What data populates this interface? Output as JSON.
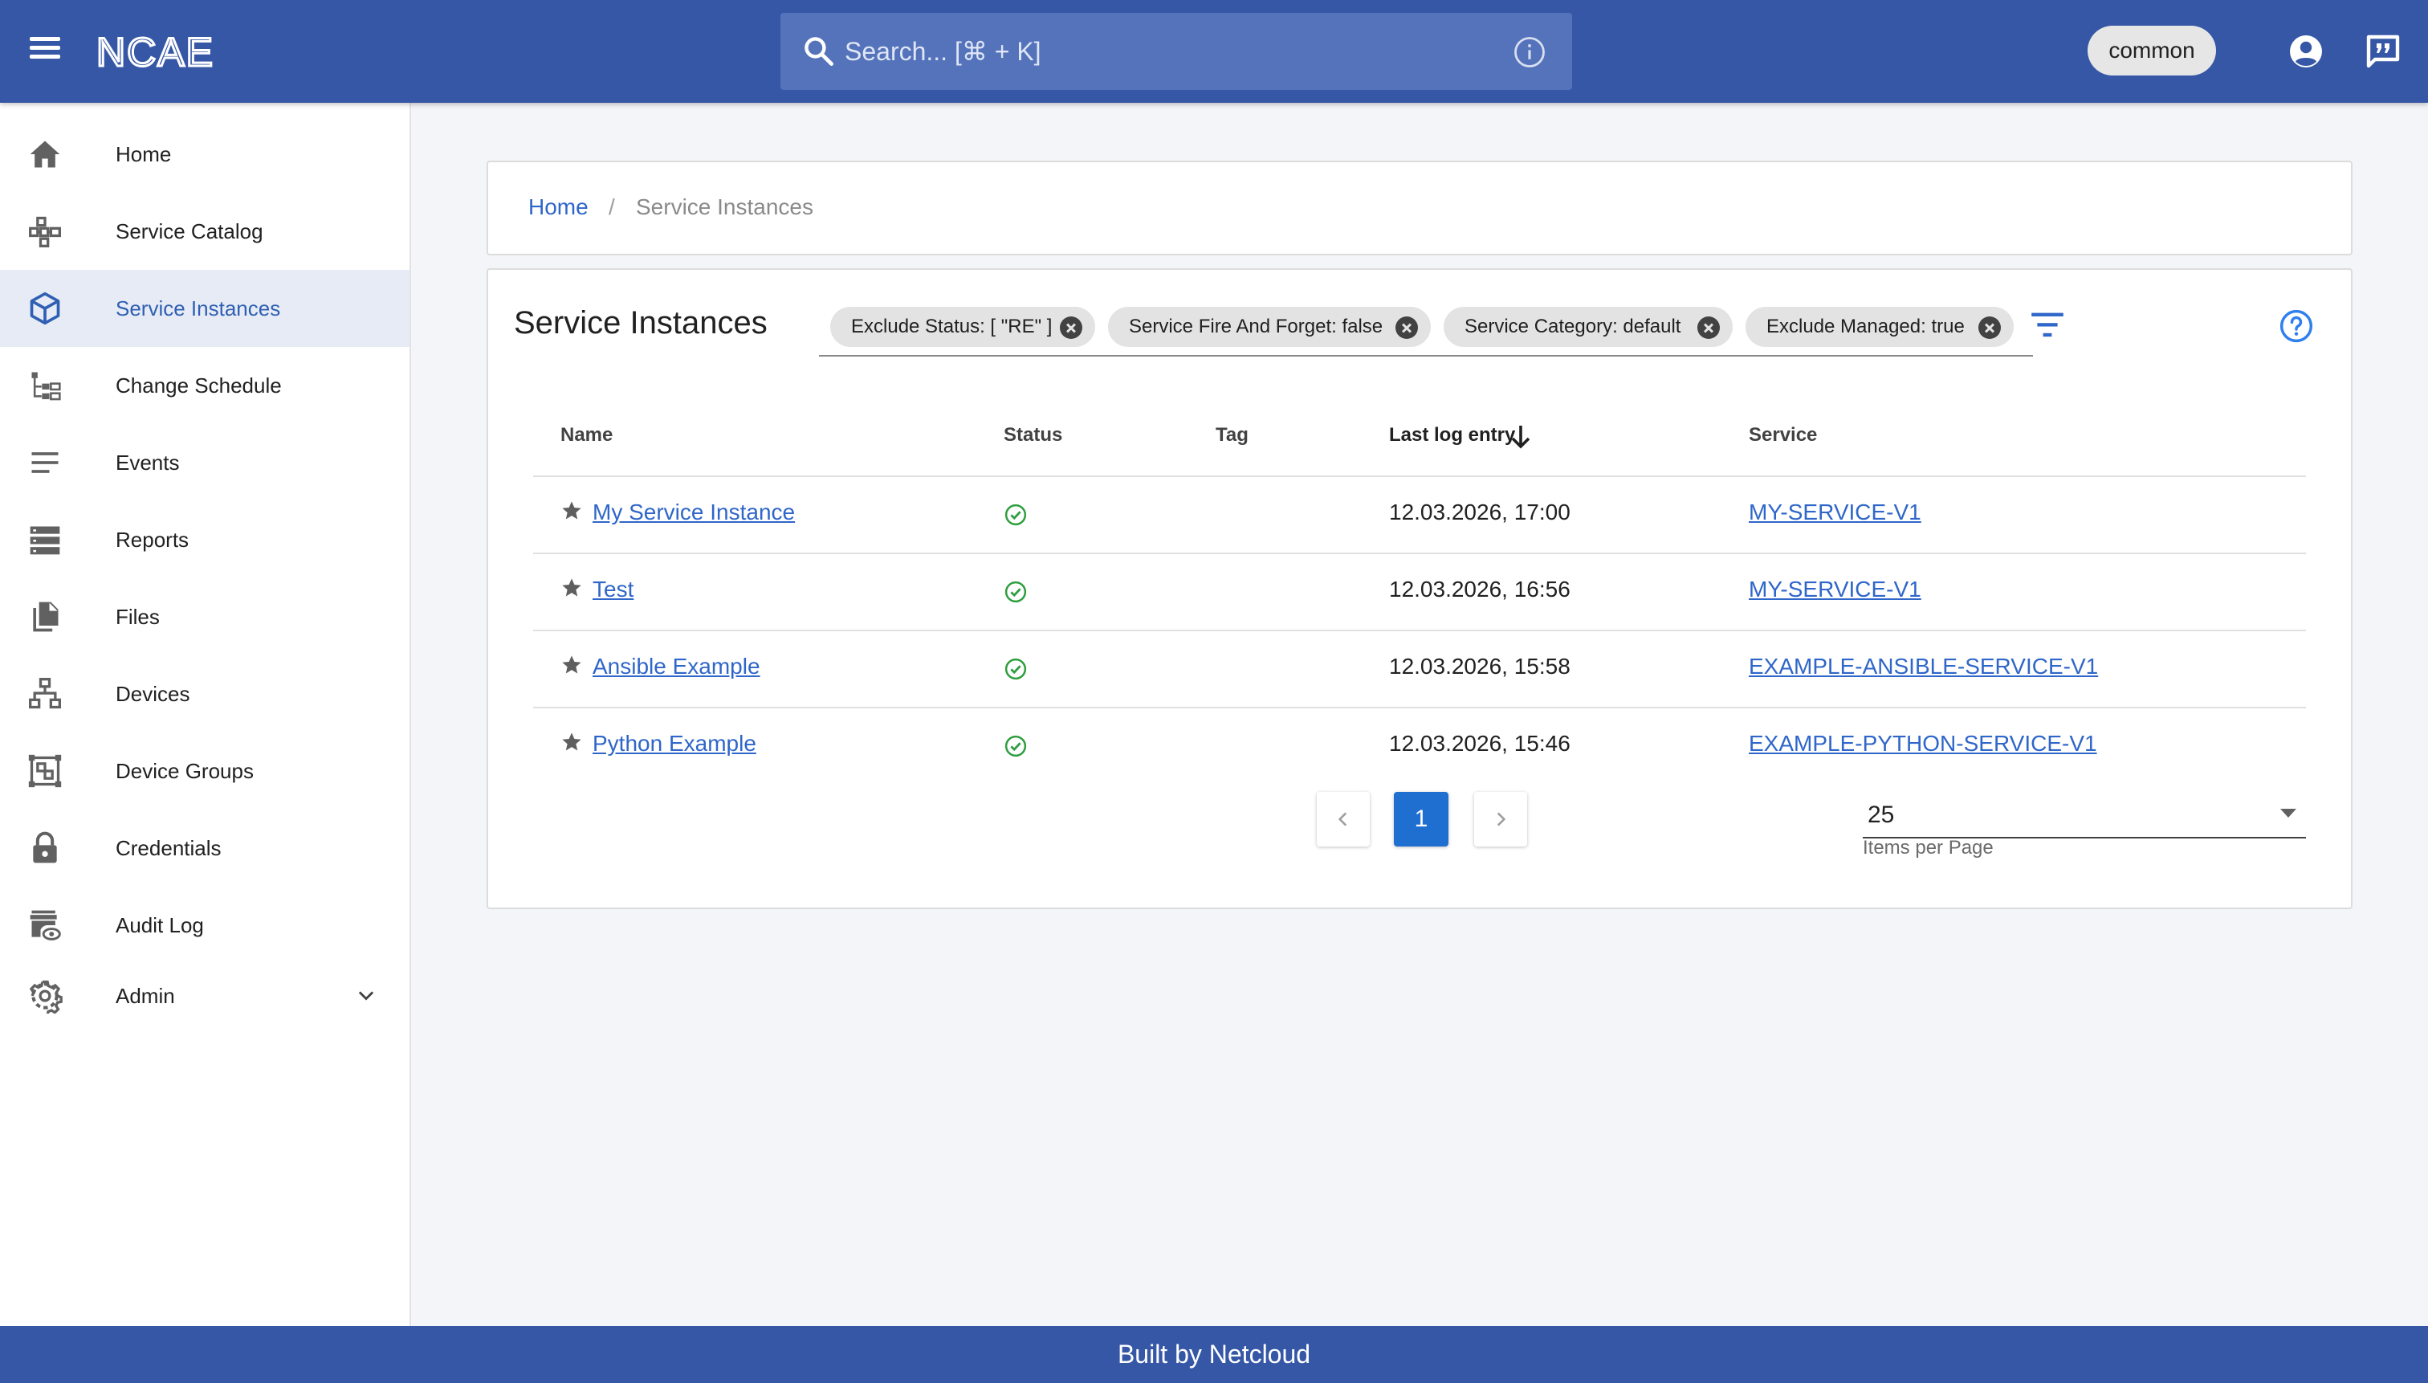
{
  "header": {
    "logo_text": "NCAE",
    "search_placeholder": "Search... [⌘ + K]",
    "tenant": "common",
    "brand_color": "#3657a6"
  },
  "sidebar": {
    "items": [
      {
        "label": "Home",
        "icon": "home-icon"
      },
      {
        "label": "Service Catalog",
        "icon": "service-catalog-icon"
      },
      {
        "label": "Service Instances",
        "icon": "cube-icon",
        "active": true
      },
      {
        "label": "Change Schedule",
        "icon": "schedule-tree-icon"
      },
      {
        "label": "Events",
        "icon": "lines-icon"
      },
      {
        "label": "Reports",
        "icon": "storage-icon"
      },
      {
        "label": "Files",
        "icon": "files-icon"
      },
      {
        "label": "Devices",
        "icon": "network-icon"
      },
      {
        "label": "Device Groups",
        "icon": "device-groups-icon"
      },
      {
        "label": "Credentials",
        "icon": "lock-icon"
      },
      {
        "label": "Audit Log",
        "icon": "audit-eye-icon"
      },
      {
        "label": "Admin",
        "icon": "gear-icon",
        "expandable": true
      }
    ]
  },
  "breadcrumb": {
    "home": "Home",
    "separator": "/",
    "current": "Service Instances"
  },
  "main": {
    "title": "Service Instances",
    "filters": [
      "Exclude Status: [ \"RE\" ]",
      "Service Fire And Forget: false",
      "Service Category: default",
      "Exclude Managed: true"
    ],
    "table": {
      "columns": [
        "Name",
        "Status",
        "Tag",
        "Last log entry",
        "Service"
      ],
      "sorted_column": "Last log entry",
      "sort_direction": "descending",
      "rows": [
        {
          "name": "My Service Instance",
          "status": "ok",
          "tag": "",
          "last_log": "12.03.2026, 17:00",
          "service": "MY-SERVICE-V1"
        },
        {
          "name": "Test",
          "status": "ok",
          "tag": "",
          "last_log": "12.03.2026, 16:56",
          "service": "MY-SERVICE-V1"
        },
        {
          "name": "Ansible Example",
          "status": "ok",
          "tag": "",
          "last_log": "12.03.2026, 15:58",
          "service": "EXAMPLE-ANSIBLE-SERVICE-V1"
        },
        {
          "name": "Python Example",
          "status": "ok",
          "tag": "",
          "last_log": "12.03.2026, 15:46",
          "service": "EXAMPLE-PYTHON-SERVICE-V1"
        }
      ]
    },
    "pagination": {
      "current_page": "1",
      "items_per_page": "25",
      "items_per_page_label": "Items per Page"
    }
  },
  "footer": {
    "text": "Built by Netcloud"
  }
}
